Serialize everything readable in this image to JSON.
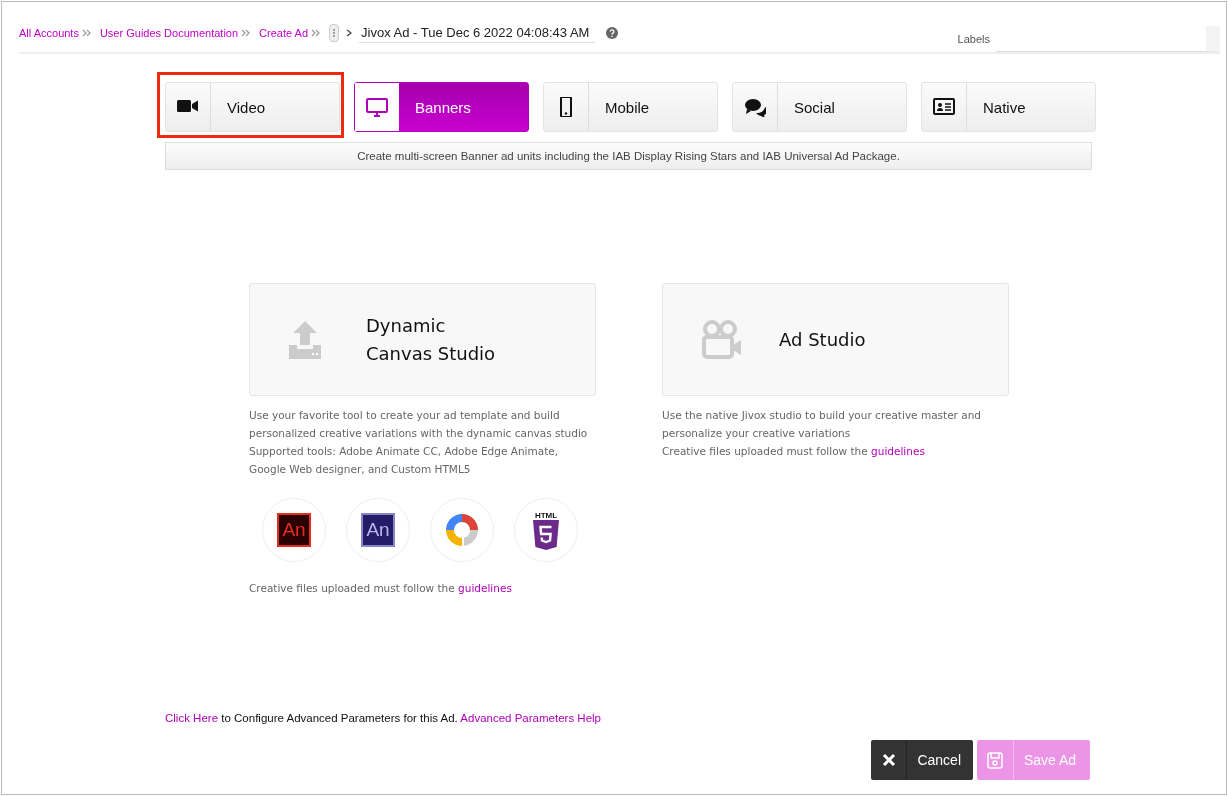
{
  "breadcrumbs": [
    {
      "label": "All Accounts"
    },
    {
      "label": "User Guides Documentation"
    },
    {
      "label": "Create Ad"
    }
  ],
  "ad_name": {
    "value": "Jivox Ad - Tue Dec 6 2022 04:08:43 AM"
  },
  "labels_field": {
    "label": "Labels"
  },
  "tabs": [
    {
      "kind": "video",
      "label": "Video",
      "selected": false,
      "highlighted": true
    },
    {
      "kind": "monitor",
      "label": "Banners",
      "selected": true,
      "highlighted": false
    },
    {
      "kind": "phone",
      "label": "Mobile",
      "selected": false,
      "highlighted": false
    },
    {
      "kind": "chat",
      "label": "Social",
      "selected": false,
      "highlighted": false
    },
    {
      "kind": "card",
      "label": "Native",
      "selected": false,
      "highlighted": false
    }
  ],
  "tab_description": "Create multi-screen Banner ad units including the IAB Display Rising Stars and IAB Universal Ad Package.",
  "options": [
    {
      "kind": "upload",
      "title_lines": [
        "Dynamic",
        "Canvas Studio"
      ],
      "description_lines": [
        "Use your favorite tool to create your ad template and build",
        "personalized creative variations with the dynamic canvas studio",
        "Supported tools: Adobe Animate CC, Adobe Edge Animate,",
        "Google Web designer, and Custom HTML5"
      ],
      "tools": [
        {
          "kind": "animate-cc",
          "label": "An"
        },
        {
          "kind": "edge-animate",
          "label": "An"
        },
        {
          "kind": "web-designer"
        },
        {
          "kind": "html5",
          "label": "HTML"
        }
      ],
      "note": "Creative files uploaded must follow the",
      "note_link": "guidelines"
    },
    {
      "kind": "camera",
      "title_lines": [
        "Ad Studio"
      ],
      "description_lines": [
        "Use the native Jivox studio to build your creative master and",
        "personalize your creative variations"
      ],
      "note": "Creative files uploaded must follow the",
      "note_link": "guidelines"
    }
  ],
  "advanced": {
    "link": "Click Here",
    "text": "to Configure Advanced Parameters for this Ad.",
    "help_link": "Advanced Parameters Help"
  },
  "buttons": [
    {
      "kind": "cancel",
      "label": "Cancel",
      "disabled": false
    },
    {
      "kind": "save",
      "label": "Save Ad",
      "disabled": true
    }
  ]
}
